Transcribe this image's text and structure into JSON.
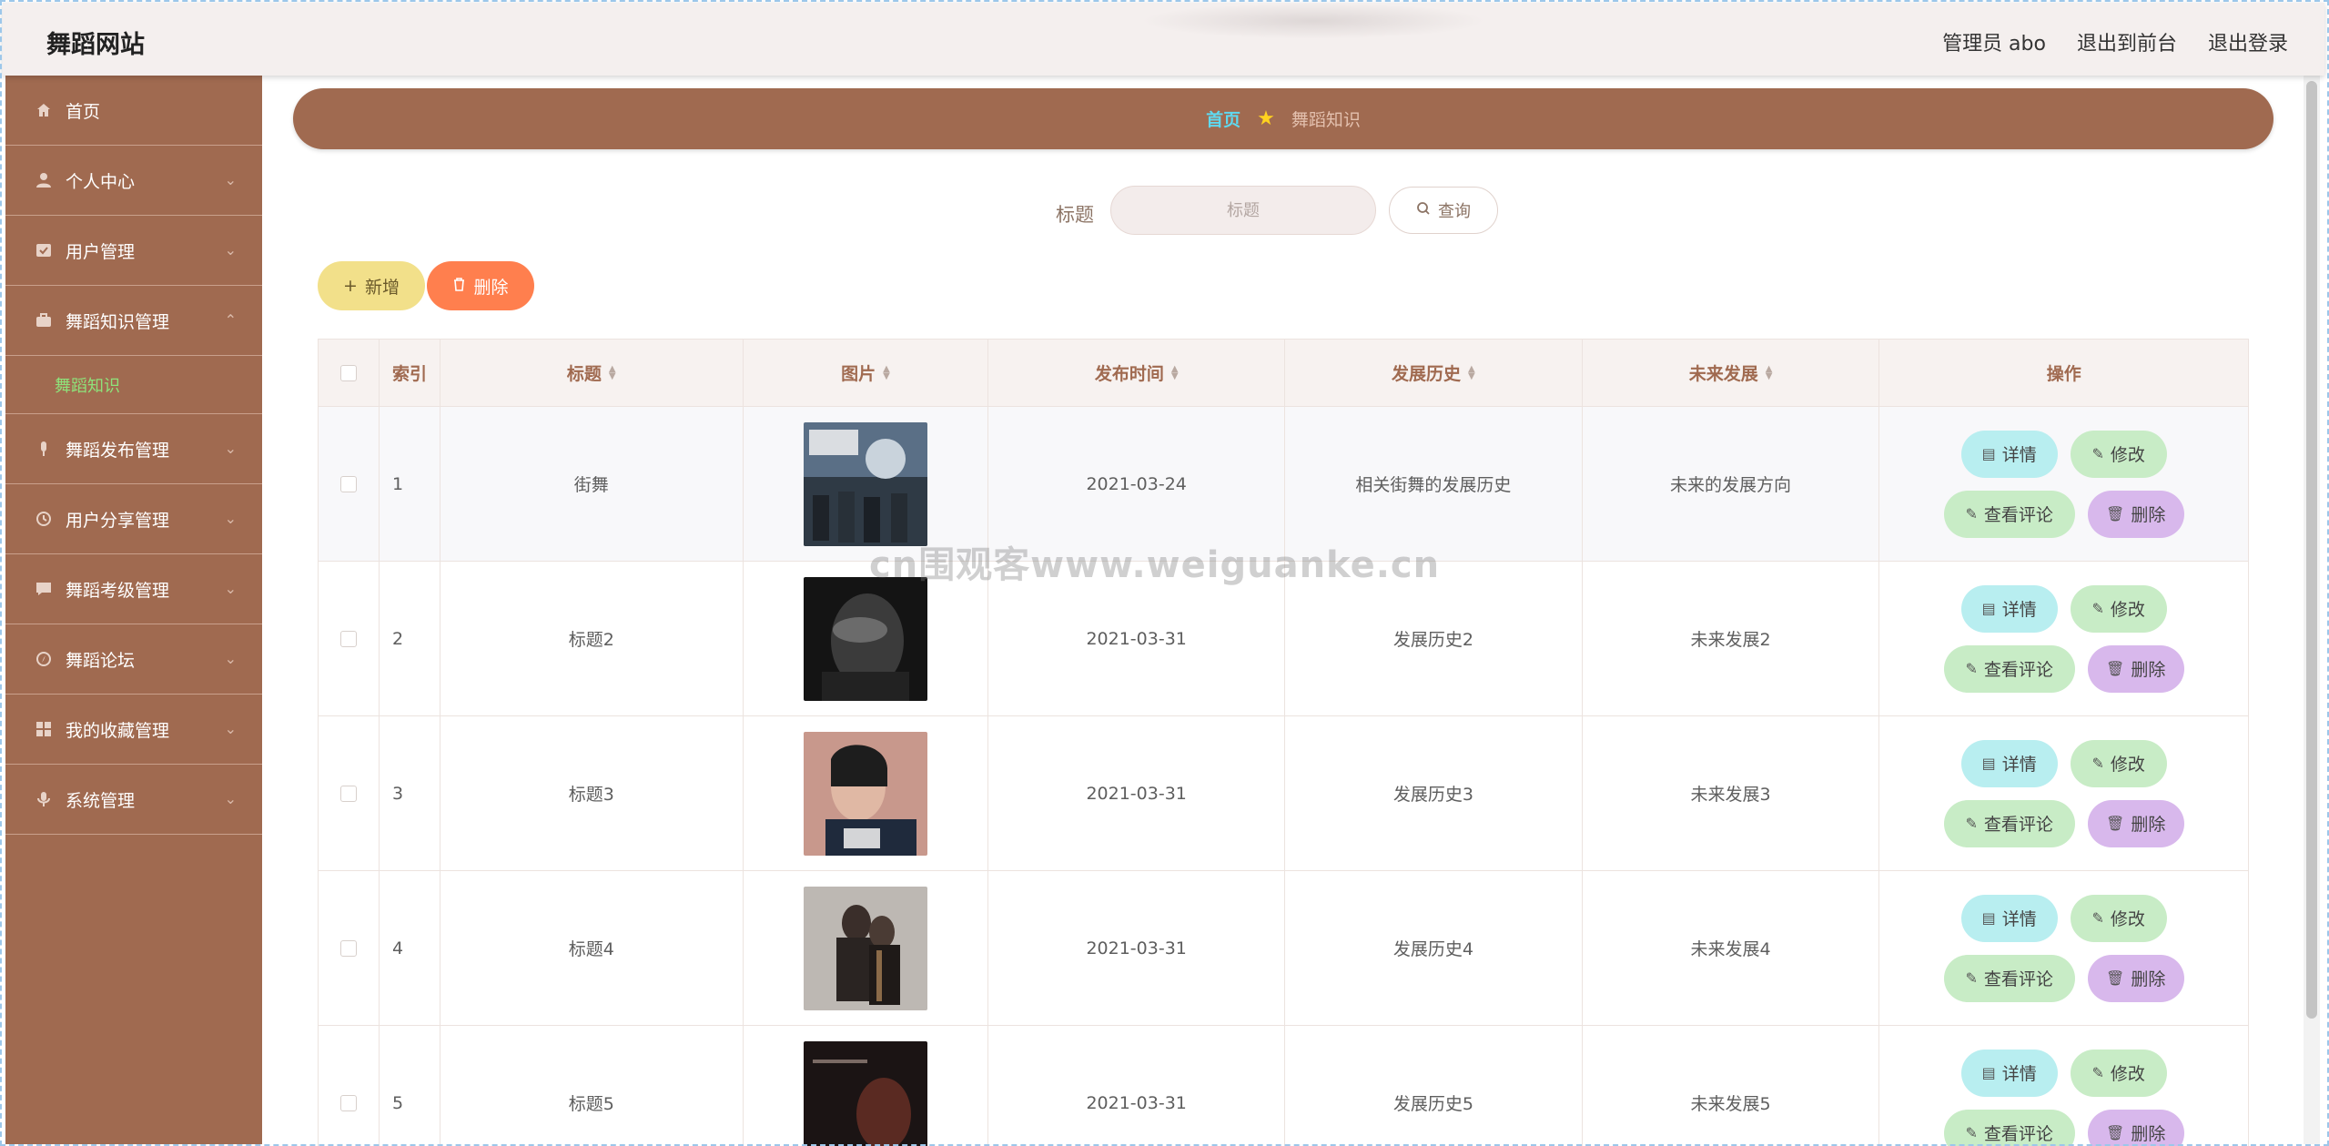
{
  "topbar": {
    "brand": "舞蹈网站",
    "admin": "管理员 abo",
    "to_front": "退出到前台",
    "logout": "退出登录"
  },
  "sidebar": {
    "items": [
      {
        "label": "首页",
        "icon": "home-icon"
      },
      {
        "label": "个人中心",
        "icon": "user-icon"
      },
      {
        "label": "用户管理",
        "icon": "list-icon"
      },
      {
        "label": "舞蹈知识管理",
        "icon": "briefcase-icon",
        "expanded": true,
        "sub": "舞蹈知识"
      },
      {
        "label": "舞蹈发布管理",
        "icon": "mic-icon"
      },
      {
        "label": "用户分享管理",
        "icon": "clock-icon"
      },
      {
        "label": "舞蹈考级管理",
        "icon": "chat-icon"
      },
      {
        "label": "舞蹈论坛",
        "icon": "compass-icon"
      },
      {
        "label": "我的收藏管理",
        "icon": "grid-icon"
      },
      {
        "label": "系统管理",
        "icon": "microphone-icon"
      }
    ]
  },
  "breadcrumb": {
    "home": "首页",
    "current": "舞蹈知识"
  },
  "search": {
    "label": "标题",
    "placeholder": "标题",
    "button": "查询"
  },
  "actions": {
    "add": "新增",
    "delete": "删除"
  },
  "table": {
    "headers": {
      "index": "索引",
      "title": "标题",
      "image": "图片",
      "date": "发布时间",
      "history": "发展历史",
      "future": "未来发展",
      "ops": "操作"
    },
    "rows": [
      {
        "index": "1",
        "title": "街舞",
        "date": "2021-03-24",
        "history": "相关街舞的发展历史",
        "future": "未来的发展方向"
      },
      {
        "index": "2",
        "title": "标题2",
        "date": "2021-03-31",
        "history": "发展历史2",
        "future": "未来发展2"
      },
      {
        "index": "3",
        "title": "标题3",
        "date": "2021-03-31",
        "history": "发展历史3",
        "future": "未来发展3"
      },
      {
        "index": "4",
        "title": "标题4",
        "date": "2021-03-31",
        "history": "发展历史4",
        "future": "未来发展4"
      },
      {
        "index": "5",
        "title": "标题5",
        "date": "2021-03-31",
        "history": "发展历史5",
        "future": "未来发展5"
      }
    ],
    "ops": {
      "detail": "详情",
      "edit": "修改",
      "comment": "查看评论",
      "delete": "删除"
    }
  },
  "watermark": "cn围观客www.weiguanke.cn",
  "colors": {
    "accent": "#a06a50",
    "topbar": "#f4efee",
    "active_sub": "#8ee27a"
  }
}
